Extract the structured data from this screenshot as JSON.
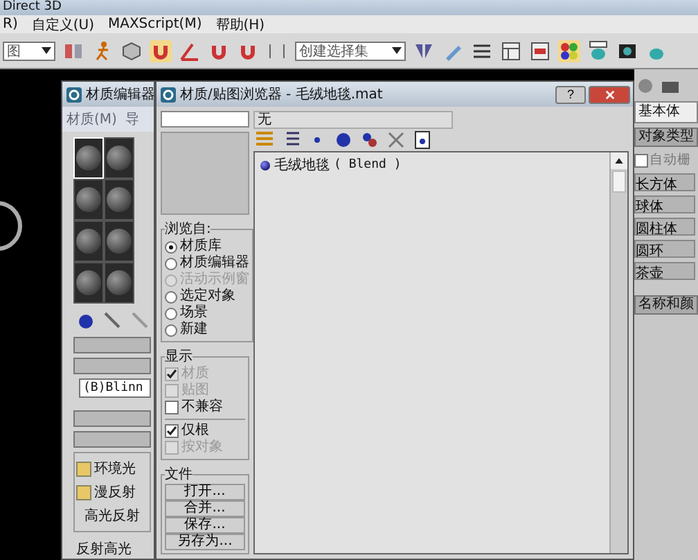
{
  "app": {
    "title": "Direct 3D",
    "menu": [
      "R)",
      "自定义(U)",
      "MAXScript(M)",
      "帮助(H)"
    ],
    "view_dropdown": "图",
    "selection_set_dropdown": "创建选择集"
  },
  "command_panel": {
    "category": "基本体",
    "rollout": "对象类型",
    "autogrid": {
      "label": "自动栅",
      "checked": false
    },
    "buttons": [
      "长方体",
      "球体",
      "圆柱体",
      "圆环",
      "茶壶"
    ],
    "rollout_2": "名称和颜"
  },
  "material_editor": {
    "title": "材质编辑器",
    "menu": [
      "材质(M)",
      "导"
    ],
    "slots": [
      {
        "selected": true
      },
      {
        "selected": false
      },
      {
        "selected": false
      },
      {
        "selected": false
      },
      {
        "selected": false
      },
      {
        "selected": false
      },
      {
        "selected": false
      },
      {
        "selected": false
      }
    ],
    "shader": "(B)Blinn",
    "params": [
      "环境光",
      "漫反射",
      "高光反射"
    ],
    "group": "反射高光"
  },
  "browser": {
    "title": "材质/贴图浏览器 - 毛绒地毯.mat",
    "help": "?",
    "name_field": "无",
    "items": [
      {
        "name": "毛绒地毯",
        "type": "( Blend )"
      }
    ],
    "browse_from": {
      "label": "浏览自:",
      "options": [
        {
          "label": "材质库",
          "selected": true,
          "disabled": false
        },
        {
          "label": "材质编辑器",
          "selected": false,
          "disabled": false
        },
        {
          "label": "活动示例窗",
          "selected": false,
          "disabled": true
        },
        {
          "label": "选定对象",
          "selected": false,
          "disabled": false
        },
        {
          "label": "场景",
          "selected": false,
          "disabled": false
        },
        {
          "label": "新建",
          "selected": false,
          "disabled": false
        }
      ]
    },
    "show": {
      "label": "显示",
      "options": [
        {
          "label": "材质",
          "checked": true,
          "disabled": true
        },
        {
          "label": "贴图",
          "checked": false,
          "disabled": true
        },
        {
          "label": "不兼容",
          "checked": false,
          "disabled": false
        },
        {
          "label": "仅根",
          "checked": true,
          "disabled": false
        },
        {
          "label": "按对象",
          "checked": false,
          "disabled": true
        }
      ]
    },
    "file": {
      "label": "文件",
      "buttons": [
        "打开...",
        "合并...",
        "保存...",
        "另存为..."
      ]
    }
  }
}
